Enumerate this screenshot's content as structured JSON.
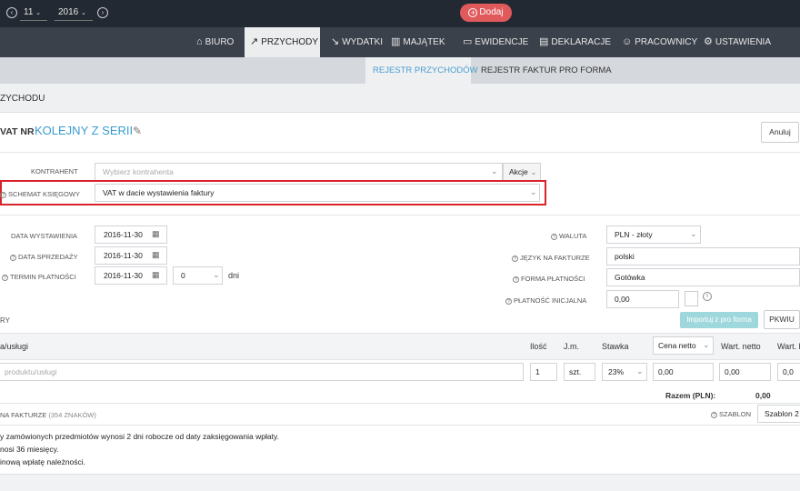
{
  "topbar": {
    "month": "11",
    "year": "2016",
    "add_label": "Dodaj"
  },
  "nav": [
    {
      "label": "BIURO",
      "icon": "home-icon"
    },
    {
      "label": "PRZYCHODY",
      "icon": "trend-up-icon"
    },
    {
      "label": "WYDATKI",
      "icon": "trend-down-icon"
    },
    {
      "label": "MAJĄTEK",
      "icon": "building-icon"
    },
    {
      "label": "EWIDENCJE",
      "icon": "folder-icon"
    },
    {
      "label": "DEKLARACJE",
      "icon": "document-icon"
    },
    {
      "label": "PRACOWNICY",
      "icon": "people-icon"
    },
    {
      "label": "USTAWIENIA",
      "icon": "gear-icon"
    }
  ],
  "subnav": [
    "REJESTR PRZYCHODÓW",
    "REJESTR FAKTUR PRO FORMA"
  ],
  "page_title": "ZYCHODU",
  "invoice": {
    "prefix": "VAT NR",
    "number_label": "KOLEJNY Z SERII",
    "cancel_label": "Anuluj"
  },
  "kontrahent": {
    "label": "KONTRAHENT",
    "placeholder": "Wybierz kontrahenta",
    "actions_label": "Akcje"
  },
  "schemat": {
    "label": "SCHEMAT KSIĘGOWY",
    "value": "VAT w dacie wystawienia faktury"
  },
  "dates": {
    "wystawienia": {
      "label": "DATA WYSTAWIENIA",
      "value": "2016-11-30"
    },
    "sprzedazy": {
      "label": "DATA SPRZEDAŻY",
      "value": "2016-11-30"
    },
    "termin": {
      "label": "TERMIN PŁATNOŚCI",
      "value": "2016-11-30",
      "days": "0",
      "days_unit": "dni"
    }
  },
  "right": {
    "waluta": {
      "label": "WALUTA",
      "value": "PLN - złoty"
    },
    "jezyk": {
      "label": "JĘZYK NA FAKTURZE",
      "value": "polski"
    },
    "forma": {
      "label": "FORMA PŁATNOŚCI",
      "value": "Gotówka"
    },
    "inicjalna": {
      "label": "PŁATNOŚĆ INICJALNA",
      "value": "0,00"
    }
  },
  "items_section": {
    "label": "RY",
    "import_button": "Importuj z pro forma",
    "pkwiu_button": "PKWIU"
  },
  "table": {
    "headers": {
      "name": "a/usługi",
      "qty": "Ilość",
      "unit": "J.m.",
      "rate": "Stawka",
      "price_type": "Cena netto",
      "net": "Wart. netto",
      "gross": "Wart. b"
    },
    "row": {
      "name_placeholder": "produktu/usługi",
      "qty": "1",
      "unit": "szt.",
      "rate": "23%",
      "price": "0,00",
      "net": "0,00",
      "gross": "0,0"
    }
  },
  "razem": {
    "label": "Razem (PLN):",
    "value": "0,00"
  },
  "uwagi": {
    "label": "NA FAKTURZE",
    "count": "(354 ZNAKÓW)",
    "szablon_label": "SZABLON",
    "szablon_value": "Szablon 2"
  },
  "notes": [
    "y zamówionych przedmiotów wynosi 2 dni robocze od daty zaksięgowania wpłaty.",
    "nosi 36 miesięcy.",
    "inową wpłatę należności."
  ]
}
